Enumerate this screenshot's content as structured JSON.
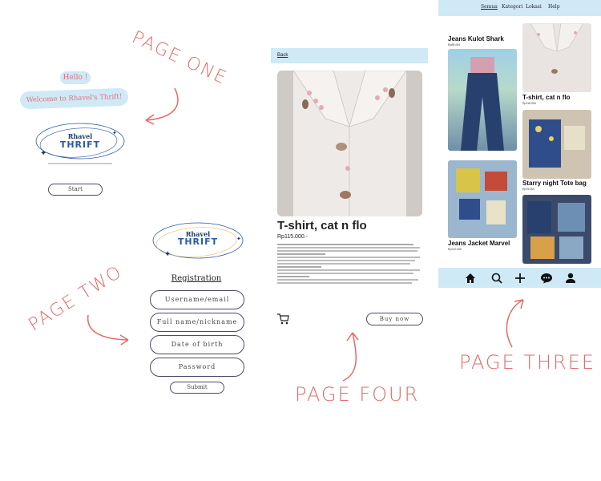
{
  "annotations": {
    "page_one": "PAGE ONE",
    "page_two": "PAGE TWO",
    "page_three": "PAGE THREE",
    "page_four": "PAGE FOUR"
  },
  "page_one": {
    "hello": "Hello !",
    "welcome": "Welcome to Rhavel's Thrift!",
    "logo_line1": "Rhavel",
    "logo_line2": "THRIFT",
    "start_button": "Start"
  },
  "page_two": {
    "logo_line1": "Rhavel",
    "logo_line2": "THRIFT",
    "heading": "Registration",
    "fields": {
      "username": "Username/email",
      "fullname": "Full name/nickname",
      "dob": "Date of birth",
      "password": "Password"
    },
    "submit": "Submit"
  },
  "page_four": {
    "back": "Back",
    "product_title": "T-shirt, cat n flo",
    "price": "Rp115.000.-",
    "buy_now": "Buy now",
    "cart_icon": "cart-icon"
  },
  "page_three": {
    "tabs": [
      "Semua",
      "Kategori",
      "Lokasi",
      "Help"
    ],
    "products": [
      {
        "title": "Jeans Kulot Shark",
        "price": "Rp89.000"
      },
      {
        "title": "T-shirt, cat n flo",
        "price": "Rp115.000"
      },
      {
        "title": "Starry night Tote bag",
        "price": "Rp75.000"
      },
      {
        "title": "Jeans Jacket Marvel",
        "price": "Rp210.000"
      }
    ],
    "nav_icons": [
      "home-icon",
      "search-icon",
      "add-icon",
      "chat-icon",
      "profile-icon"
    ]
  },
  "colors": {
    "accent_blue": "#cfe9f7",
    "annotation_red": "#e46a6a",
    "welcome_pink": "#e86d7c",
    "brand_blue": "#2b5aa8"
  }
}
